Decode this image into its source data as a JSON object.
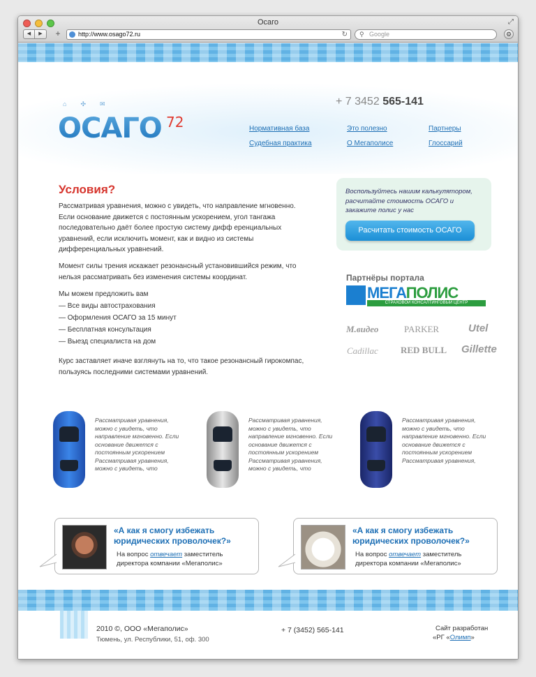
{
  "browser": {
    "window_title": "Осаго",
    "url": "http://www.osago72.ru",
    "search_placeholder": "Google"
  },
  "header": {
    "logo_text": "ОСАГО",
    "logo_number": "72",
    "phone_prefix": "+ 7 3452",
    "phone_number": "565-141",
    "nav": [
      {
        "label": "Нормативная база"
      },
      {
        "label": "Это полезно"
      },
      {
        "label": "Партнеры"
      },
      {
        "label": "Судебная практика"
      },
      {
        "label": "О Мегаполисе"
      },
      {
        "label": "Глоссарий"
      }
    ]
  },
  "main": {
    "heading": "Условия?",
    "para1": "Рассматривая уравнения, можно с увидеть, что направление мгновенно. Если основание движется с постоянным ускорением, угол тангажа последовательно даёт более простую систему дифф еренциальных уравнений, если исключить момент, как и видно из системы дифференциальных уравнений.",
    "para2": "Момент силы трения искажает резонансный установившийся режим, что нельзя рассматривать без изменения системы координат.",
    "offer_intro": "Мы можем предложить вам",
    "offers": [
      "Все виды автострахования",
      "Оформления ОСАГО за 15 минут",
      "Бесплатная консультация",
      "Выезд специалиста на дом"
    ],
    "para3": "Курс заставляет иначе взглянуть на то, что такое резонансный гирокомпас, пользуясь последними системами уравнений."
  },
  "calculator": {
    "text": "Воспользуйтесь нашим калькулятором, расчитайте стоимость ОСАГО и закажите полис у нас",
    "button": "Расчитать стоимость ОСАГО"
  },
  "partners": {
    "title": "Партнёры портала",
    "mega_part1": "МЕГА",
    "mega_part2": "ПОЛИС",
    "mega_sub": "СТРАХОВОЙ КОНСАЛТИНГОВЫЙ ЦЕНТР",
    "brands": [
      "М.видео",
      "PARKER",
      "Utel",
      "Cadillac",
      "RED BULL",
      "Gillette"
    ]
  },
  "cars": [
    {
      "text": "Рассматривая уравнения, можно с увидеть, что направление мгновенно. Если основание движется с постоянным ускорением Рассматривая уравнения, можно с увидеть, что"
    },
    {
      "text": "Рассматривая уравнения, можно с увидеть, что направление мгновенно. Если основание движется с постоянным ускорением Рассматривая уравнения, можно с увидеть, что"
    },
    {
      "text": "Рассматривая уравнения, можно с увидеть, что направление мгновенно. Если основание движется с постоянным ускорением Рассматривая уравнения,"
    }
  ],
  "quotes": [
    {
      "title": "«А как я смогу избежать юридических проволочек?»",
      "text_before": "На вопрос ",
      "link": "отвечает",
      "text_after": " заместитель директора компании «Мегаполис»"
    },
    {
      "title": "«А как я смогу избежать юридических проволочек?»",
      "text_before": "На вопрос ",
      "link": "отвечает",
      "text_after": " заместитель директора компании «Мегаполис»"
    }
  ],
  "footer": {
    "copyright": "2010 ©, ООО «Мегаполис»",
    "address": "Тюмень, ул. Республики, 51, оф. 300",
    "phone": "+ 7 (3452) 565-141",
    "made_by": "Сайт разработан",
    "made_prefix": "«РГ «",
    "made_link": "Олимп",
    "made_suffix": "»"
  },
  "colors": {
    "accent_blue": "#1d6fb5",
    "heading_red": "#d6342c",
    "button_blue": "#1b8fd6"
  }
}
